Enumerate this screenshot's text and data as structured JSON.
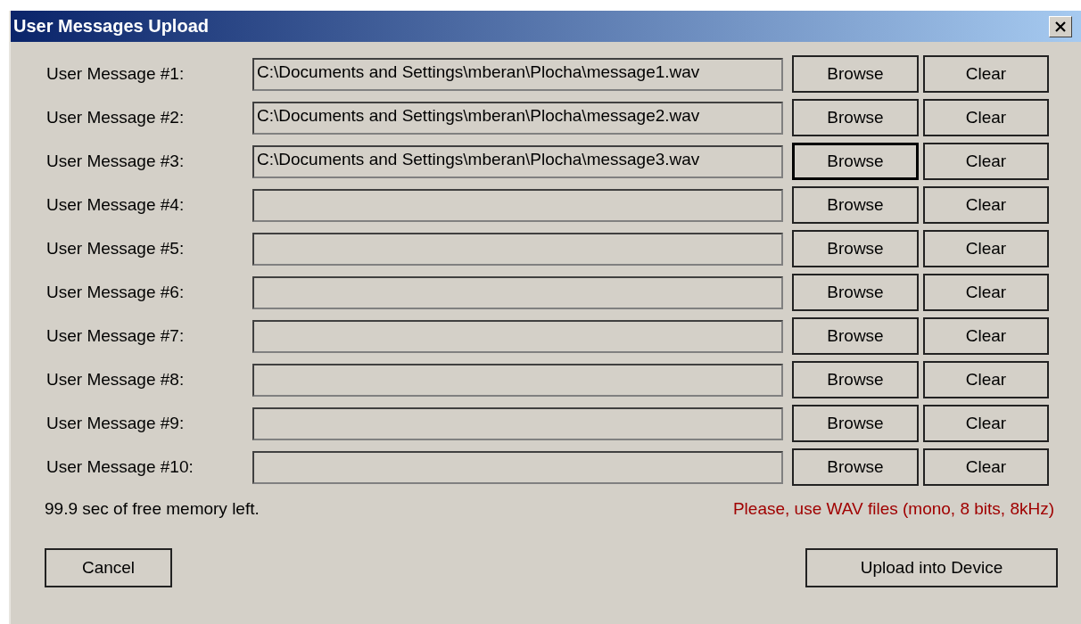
{
  "window": {
    "title": "User Messages Upload"
  },
  "rows": [
    {
      "label": "User Message #1:",
      "value": "C:\\Documents and Settings\\mberan\\Plocha\\message1.wav",
      "browse": "Browse",
      "clear": "Clear",
      "browse_focused": false
    },
    {
      "label": "User Message #2:",
      "value": "C:\\Documents and Settings\\mberan\\Plocha\\message2.wav",
      "browse": "Browse",
      "clear": "Clear",
      "browse_focused": false
    },
    {
      "label": "User Message #3:",
      "value": "C:\\Documents and Settings\\mberan\\Plocha\\message3.wav",
      "browse": "Browse",
      "clear": "Clear",
      "browse_focused": true
    },
    {
      "label": "User Message #4:",
      "browse": "Browse",
      "clear": "Clear",
      "browse_focused": false
    },
    {
      "label": "User Message #5:",
      "browse": "Browse",
      "clear": "Clear",
      "browse_focused": false
    },
    {
      "label": "User Message #6:",
      "browse": "Browse",
      "clear": "Clear",
      "browse_focused": false
    },
    {
      "label": "User Message #7:",
      "browse": "Browse",
      "clear": "Clear",
      "browse_focused": false
    },
    {
      "label": "User Message #8:",
      "browse": "Browse",
      "clear": "Clear",
      "browse_focused": false
    },
    {
      "label": "User Message #9:",
      "browse": "Browse",
      "clear": "Clear",
      "browse_focused": false
    },
    {
      "label": "User Message #10:",
      "browse": "Browse",
      "clear": "Clear",
      "browse_focused": false
    }
  ],
  "memory_status": "99.9 sec of free memory left.",
  "format_hint": "Please, use WAV files (mono, 8 bits, 8kHz)",
  "buttons": {
    "cancel": "Cancel",
    "upload": "Upload into Device"
  }
}
